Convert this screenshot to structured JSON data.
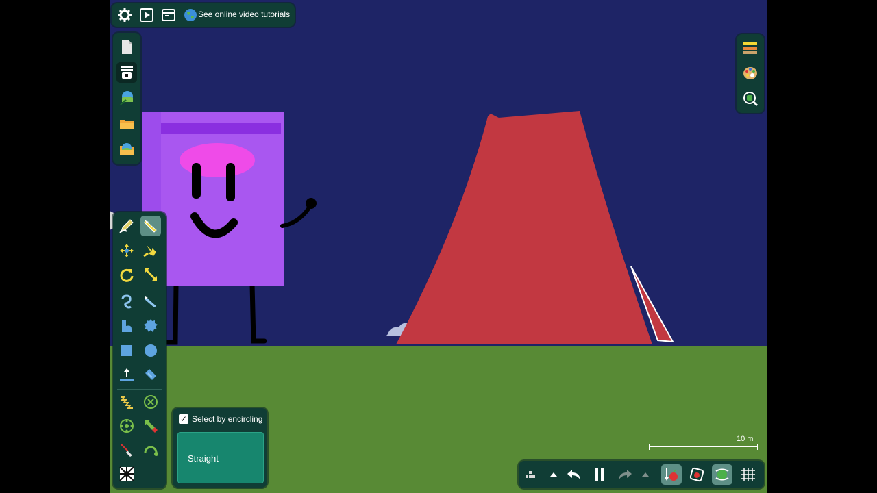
{
  "top_bar": {
    "settings_icon": "gear-icon",
    "play_icon": "play-square-icon",
    "window_icon": "window-icon",
    "globe_icon": "globe-icon",
    "tutorials_label": "See online video tutorials"
  },
  "file_panel": {
    "items": [
      "new-file-icon",
      "layers-icon",
      "scene-settings-icon",
      "open-folder-icon",
      "example-scenes-icon"
    ]
  },
  "right_panel": {
    "items": [
      "background-layers-icon",
      "palette-icon",
      "zoom-icon"
    ]
  },
  "tools": {
    "items": [
      "draw-tool-icon",
      "select-tool-icon",
      "move-tool-icon",
      "drag-tool-icon",
      "rotate-tool-icon",
      "scale-tool-icon",
      "sketch-tool-icon",
      "knife-tool-icon",
      "brush-tool-icon",
      "gear-shape-icon",
      "box-tool-icon",
      "circle-tool-icon",
      "plane-tool-icon",
      "chain-tool-icon",
      "spring-tool-icon",
      "fixate-tool-icon",
      "axle-tool-icon",
      "tracer-tool-icon",
      "laser-tool-icon",
      "hinge-tool-icon",
      "texture-tool-icon"
    ],
    "active": "select-tool-icon"
  },
  "select_options": {
    "encircle_checked": true,
    "encircle_label": "Select by encircling",
    "mode_label": "Straight"
  },
  "scale": {
    "label": "10 m"
  },
  "sim_bar": {
    "items": [
      "grid-dots-icon",
      "chevron-up-icon",
      "undo-icon",
      "pause-icon",
      "redo-icon",
      "chevron-up-icon-2",
      "gravity-icon",
      "air-friction-icon",
      "controller-icon",
      "grid-icon"
    ]
  },
  "colors": {
    "sky": "#1e2466",
    "ground": "#588a35",
    "panel": "#103d35",
    "accent": "#17866e",
    "character": "#a957f0",
    "volcano": "#c23841"
  }
}
